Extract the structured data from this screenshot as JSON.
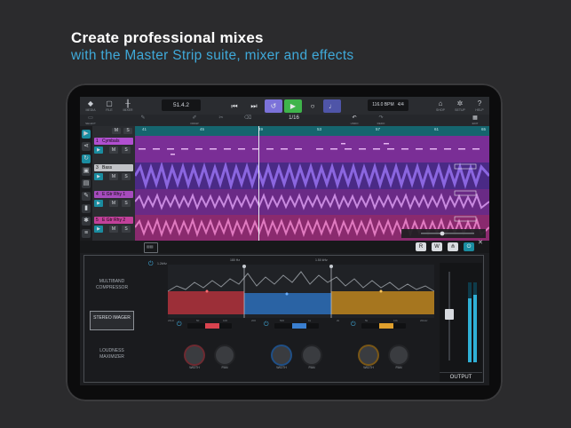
{
  "headline": "Create professional mixes",
  "subline": "with the Master Strip suite, mixer and effects",
  "toolbar": {
    "media_label": "MEDIA",
    "file_label": "FILE",
    "mixer_label": "MIXER",
    "position": "51.4.2",
    "bpm": "116.0 BPM",
    "signature": "4/4",
    "shop_label": "SHOP",
    "setup_label": "SETUP",
    "help_label": "HELP"
  },
  "toolbar2": {
    "select_label": "SELECT",
    "draw_label": "DRAW",
    "snap_value": "1/16",
    "undo_label": "UNDO",
    "redo_label": "REDO",
    "edit_label": "EDIT"
  },
  "ruler": [
    "41",
    "45",
    "49",
    "53",
    "57",
    "61",
    "65"
  ],
  "tracks": [
    {
      "num": "1",
      "name": "Cymbals",
      "color": "#b14fd0"
    },
    {
      "num": "3",
      "name": "Bass",
      "color": "#c0c2c6"
    },
    {
      "num": "4",
      "name": "E Gtr Rhy 1",
      "color": "#a64bbd"
    },
    {
      "num": "5",
      "name": "E Gtr Rhy 2",
      "color": "#c2409a"
    }
  ],
  "mixer_buttons": {
    "r": "R",
    "w": "W"
  },
  "master": {
    "sidebar": [
      {
        "label": "MULTIBAND COMPRESSOR",
        "selected": false
      },
      {
        "label": "STEREO IMAGER",
        "selected": true
      },
      {
        "label": "LOUDNESS MAXIMIZER",
        "selected": false
      }
    ],
    "spectrum": {
      "low_label": "1.2kHz",
      "mid_label": "180 Hz",
      "high_label": "1.50 kHz",
      "axis": [
        "20Hz",
        "50",
        "100",
        "200",
        "500",
        "1k",
        "2k",
        "5k",
        "10k",
        "20kHz"
      ]
    },
    "bands": [
      {
        "color": "#d9434f",
        "width_label": "WIDTH",
        "pan_label": "PAN"
      },
      {
        "color": "#3a7fd0",
        "width_label": "WIDTH",
        "pan_label": "PAN"
      },
      {
        "color": "#e0a02d",
        "width_label": "WIDTH",
        "pan_label": "PAN"
      }
    ],
    "output_label": "OUTPUT",
    "meter_levels": [
      0.8,
      0.85
    ]
  }
}
